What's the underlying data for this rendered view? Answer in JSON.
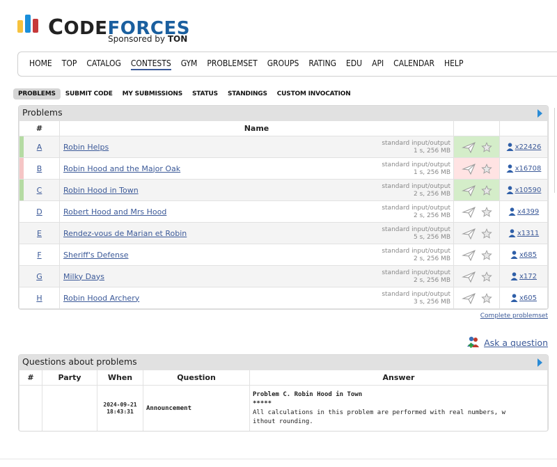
{
  "logo": {
    "word_code_first": "C",
    "word_code_rest": "ODE",
    "word_forces": "FORCES",
    "sponsor_prefix": "Sponsored by",
    "sponsor_name": "TON",
    "colors": {
      "yellow": "#f6c23e",
      "blue": "#1a8fdb",
      "red": "#c6393a",
      "forces": "#1a5f9f"
    }
  },
  "nav": {
    "items": [
      "HOME",
      "TOP",
      "CATALOG",
      "CONTESTS",
      "GYM",
      "PROBLEMSET",
      "GROUPS",
      "RATING",
      "EDU",
      "API",
      "CALENDAR",
      "HELP"
    ],
    "active": "CONTESTS"
  },
  "submenu": {
    "items": [
      "PROBLEMS",
      "SUBMIT CODE",
      "MY SUBMISSIONS",
      "STATUS",
      "STANDINGS",
      "CUSTOM INVOCATION"
    ],
    "active": "PROBLEMS"
  },
  "problems": {
    "caption": "Problems",
    "headers": {
      "id": "#",
      "name": "Name"
    },
    "rows": [
      {
        "id": "A",
        "name": "Robin Helps",
        "io": "standard input/output",
        "limits": "1 s, 256 MB",
        "solved": "x22426",
        "status": "accepted"
      },
      {
        "id": "B",
        "name": "Robin Hood and the Major Oak",
        "io": "standard input/output",
        "limits": "1 s, 256 MB",
        "solved": "x16708",
        "status": "rejected"
      },
      {
        "id": "C",
        "name": "Robin Hood in Town",
        "io": "standard input/output",
        "limits": "2 s, 256 MB",
        "solved": "x10590",
        "status": "accepted"
      },
      {
        "id": "D",
        "name": "Robert Hood and Mrs Hood",
        "io": "standard input/output",
        "limits": "2 s, 256 MB",
        "solved": "x4399",
        "status": "none"
      },
      {
        "id": "E",
        "name": "Rendez-vous de Marian et Robin",
        "io": "standard input/output",
        "limits": "5 s, 256 MB",
        "solved": "x1311",
        "status": "none"
      },
      {
        "id": "F",
        "name": "Sheriff's Defense",
        "io": "standard input/output",
        "limits": "2 s, 256 MB",
        "solved": "x685",
        "status": "none"
      },
      {
        "id": "G",
        "name": "Milky Days",
        "io": "standard input/output",
        "limits": "2 s, 256 MB",
        "solved": "x172",
        "status": "none"
      },
      {
        "id": "H",
        "name": "Robin Hood Archery",
        "io": "standard input/output",
        "limits": "3 s, 256 MB",
        "solved": "x605",
        "status": "none"
      }
    ],
    "status_colors": {
      "accepted": "#d4edc9",
      "rejected": "#ffe3e3",
      "accepted_strip": "#b5dba3",
      "rejected_strip": "#f5c5c5"
    }
  },
  "links": {
    "complete_problemset": "Complete problemset",
    "ask_question": "Ask a question"
  },
  "questions": {
    "caption": "Questions about problems",
    "headers": {
      "id": "#",
      "party": "Party",
      "when": "When",
      "question": "Question",
      "answer": "Answer"
    },
    "rows": [
      {
        "id": "",
        "party": "",
        "when_date": "2024-09-21",
        "when_time": "18:43:31",
        "question": "Announcement",
        "answer_title": "Problem C. Robin Hood in Town",
        "answer_stars": "*****",
        "answer_line1": "All calculations in this problem are performed with real numbers, w",
        "answer_line2": "ithout rounding."
      }
    ]
  }
}
